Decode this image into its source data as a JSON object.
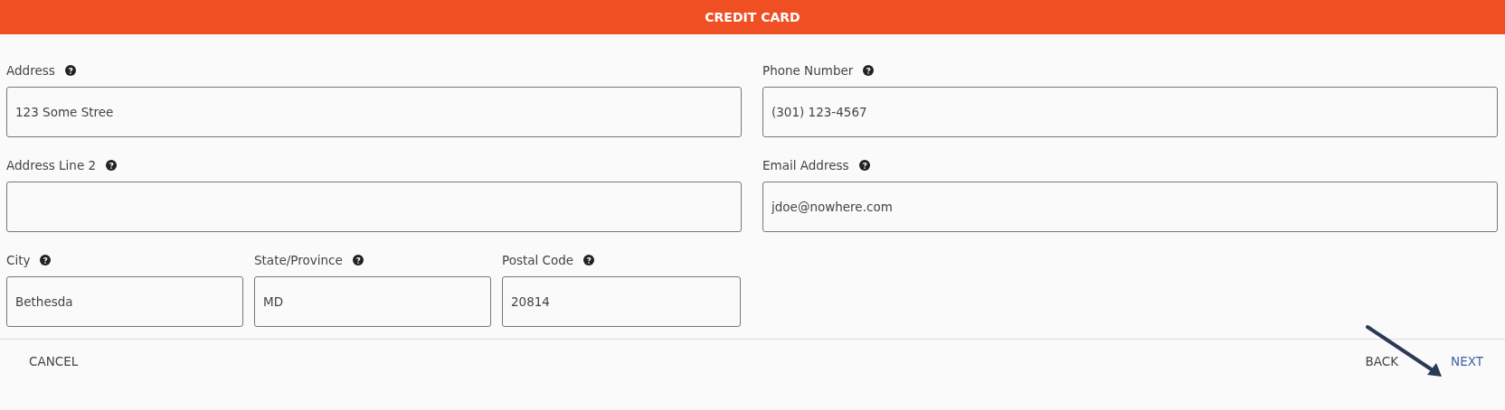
{
  "header": {
    "title": "CREDIT CARD"
  },
  "left_fields": [
    {
      "label": "Address",
      "value": "123 Some Stree"
    },
    {
      "label": "Address Line 2"
    }
  ],
  "bottom_fields": [
    {
      "label": "City",
      "value": "Bethesda"
    },
    {
      "label": "State/Province",
      "value": "MD"
    },
    {
      "label": "Postal Code",
      "value": "20814"
    }
  ],
  "right_fields": [
    {
      "label": "Phone Number",
      "value": "(301) 123-4567"
    },
    {
      "label": "Email Address",
      "value": "jdoe@nowhere.com"
    }
  ],
  "footer": {
    "buttons": [
      {
        "label": "CANCEL",
        "kind": "secondary"
      },
      {
        "label": "BACK",
        "kind": "secondary"
      },
      {
        "label": "NEXT",
        "kind": "primary"
      }
    ]
  }
}
